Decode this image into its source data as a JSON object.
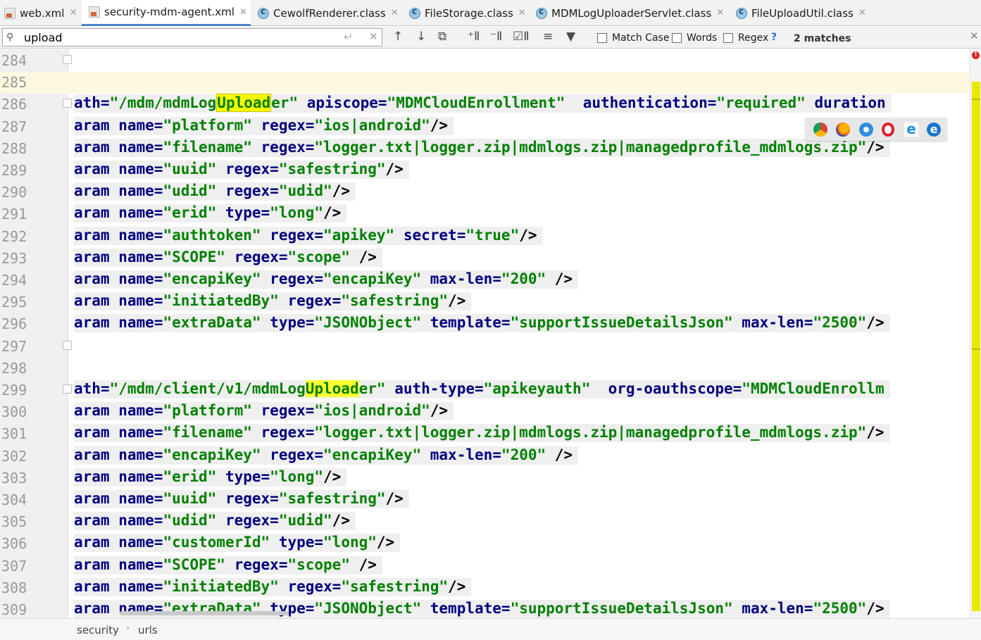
{
  "tabs": [
    {
      "label": "web.xml",
      "icon": "xml-file-icon",
      "active": false
    },
    {
      "label": "security-mdm-agent.xml",
      "icon": "xml-file-icon",
      "active": true
    },
    {
      "label": "CewolfRenderer.class",
      "icon": "class-file-icon",
      "active": false
    },
    {
      "label": "FileStorage.class",
      "icon": "class-file-icon",
      "active": false
    },
    {
      "label": "MDMLogUploaderServlet.class",
      "icon": "class-file-icon",
      "active": false
    },
    {
      "label": "FileUploadUtil.class",
      "icon": "class-file-icon",
      "active": false
    }
  ],
  "search": {
    "query": "upload",
    "match_case_label": "Match Case",
    "words_label": "Words",
    "regex_label": "Regex",
    "help_label": "?",
    "matches_text": "2 matches"
  },
  "editor": {
    "lines": [
      {
        "n": "284",
        "html": ""
      },
      {
        "n": "285",
        "html": ""
      },
      {
        "n": "286",
        "html": "<span class='k'>ath=</span><span class='v'>\"/mdm/mdmLog</span><span class='hl'>Upload</span><span class='v'>er\"</span> <span class='k'>apiscope=</span><span class='v'>\"MDMCloudEnrollment\"</span>  <span class='k'>authentication=</span><span class='v'>\"required\"</span> <span class='k'>duration</span>"
      },
      {
        "n": "287",
        "html": "<span class='k'>aram name=</span><span class='v'>\"platform\"</span> <span class='k'>regex=</span><span class='v'>\"ios|android\"</span>/&gt;"
      },
      {
        "n": "288",
        "html": "<span class='k'>aram name=</span><span class='v'>\"filename\"</span> <span class='k'>regex=</span><span class='v'>\"logger.txt|logger.zip|mdmlogs.zip|managedprofile_mdmlogs.zip\"</span>/&gt;"
      },
      {
        "n": "289",
        "html": "<span class='k'>aram name=</span><span class='v'>\"uuid\"</span> <span class='k'>regex=</span><span class='v'>\"safestring\"</span>/&gt;"
      },
      {
        "n": "290",
        "html": "<span class='k'>aram name=</span><span class='v'>\"udid\"</span> <span class='k'>regex=</span><span class='v'>\"udid\"</span>/&gt;"
      },
      {
        "n": "291",
        "html": "<span class='k'>aram name=</span><span class='v'>\"erid\"</span> <span class='k'>type=</span><span class='v'>\"long\"</span>/&gt;"
      },
      {
        "n": "292",
        "html": "<span class='k'>aram name=</span><span class='v'>\"authtoken\"</span> <span class='k'>regex=</span><span class='v'>\"apikey\"</span> <span class='k'>secret=</span><span class='v'>\"true\"</span>/&gt;"
      },
      {
        "n": "293",
        "html": "<span class='k'>aram name=</span><span class='v'>\"SCOPE\"</span> <span class='k'>regex=</span><span class='v'>\"scope\"</span> /&gt;"
      },
      {
        "n": "294",
        "html": "<span class='k'>aram name=</span><span class='v'>\"encapiKey\"</span> <span class='k'>regex=</span><span class='v'>\"encapiKey\"</span> <span class='k'>max-len=</span><span class='v'>\"200\"</span> /&gt;"
      },
      {
        "n": "295",
        "html": "<span class='k'>aram name=</span><span class='v'>\"initiatedBy\"</span> <span class='k'>regex=</span><span class='v'>\"safestring\"</span>/&gt;"
      },
      {
        "n": "296",
        "html": "<span class='k'>aram name=</span><span class='v'>\"extraData\"</span> <span class='k'>type=</span><span class='v'>\"JSONObject\"</span> <span class='k'>template=</span><span class='v'>\"supportIssueDetailsJson\"</span> <span class='k'>max-len=</span><span class='v'>\"2500\"</span>/&gt;"
      },
      {
        "n": "297",
        "html": ""
      },
      {
        "n": "298",
        "html": ""
      },
      {
        "n": "299",
        "html": "<span class='k'>ath=</span><span class='v'>\"/mdm/client/v1/mdmLog</span><span class='hl2'>Upload</span><span class='v'>er\"</span> <span class='k'>auth-type=</span><span class='v'>\"apikeyauth\"</span>  <span class='k'>org-oauthscope=</span><span class='v'>\"MDMCloudEnrollm</span>"
      },
      {
        "n": "300",
        "html": "<span class='k'>aram name=</span><span class='v'>\"platform\"</span> <span class='k'>regex=</span><span class='v'>\"ios|android\"</span>/&gt;"
      },
      {
        "n": "301",
        "html": "<span class='k'>aram name=</span><span class='v'>\"filename\"</span> <span class='k'>regex=</span><span class='v'>\"logger.txt|logger.zip|mdmlogs.zip|managedprofile_mdmlogs.zip\"</span>/&gt;"
      },
      {
        "n": "302",
        "html": "<span class='k'>aram name=</span><span class='v'>\"encapiKey\"</span> <span class='k'>regex=</span><span class='v'>\"encapiKey\"</span> <span class='k'>max-len=</span><span class='v'>\"200\"</span> /&gt;"
      },
      {
        "n": "303",
        "html": "<span class='k'>aram name=</span><span class='v'>\"erid\"</span> <span class='k'>type=</span><span class='v'>\"long\"</span>/&gt;"
      },
      {
        "n": "304",
        "html": "<span class='k'>aram name=</span><span class='v'>\"uuid\"</span> <span class='k'>regex=</span><span class='v'>\"safestring\"</span>/&gt;"
      },
      {
        "n": "305",
        "html": "<span class='k'>aram name=</span><span class='v'>\"udid\"</span> <span class='k'>regex=</span><span class='v'>\"udid\"</span>/&gt;"
      },
      {
        "n": "306",
        "html": "<span class='k'>aram name=</span><span class='v'>\"customerId\"</span> <span class='k'>type=</span><span class='v'>\"long\"</span>/&gt;"
      },
      {
        "n": "307",
        "html": "<span class='k'>aram name=</span><span class='v'>\"SCOPE\"</span> <span class='k'>regex=</span><span class='v'>\"scope\"</span> /&gt;"
      },
      {
        "n": "308",
        "html": "<span class='k'>aram name=</span><span class='v'>\"initiatedBy\"</span> <span class='k'>regex=</span><span class='v'>\"safestring\"</span>/&gt;"
      },
      {
        "n": "309",
        "html": "<span class='k'>aram name=</span><span class='v'>\"extraData\"</span> <span class='k'>type=</span><span class='v'>\"JSONObject\"</span> <span class='k'>template=</span><span class='v'>\"supportIssueDetailsJson\"</span> <span class='k'>max-len=</span><span class='v'>\"2500\"</span>/&gt;"
      }
    ]
  },
  "browser_icons": [
    "chrome-icon",
    "firefox-icon",
    "safari-icon",
    "opera-icon",
    "ie-icon",
    "edge-icon"
  ],
  "breadcrumb": {
    "items": [
      "security",
      "urls"
    ]
  },
  "colors": {
    "tag_attr": "#000080",
    "attr_value": "#008000",
    "match_highlight": "#f8f800",
    "current_line": "#fdf9e1"
  }
}
